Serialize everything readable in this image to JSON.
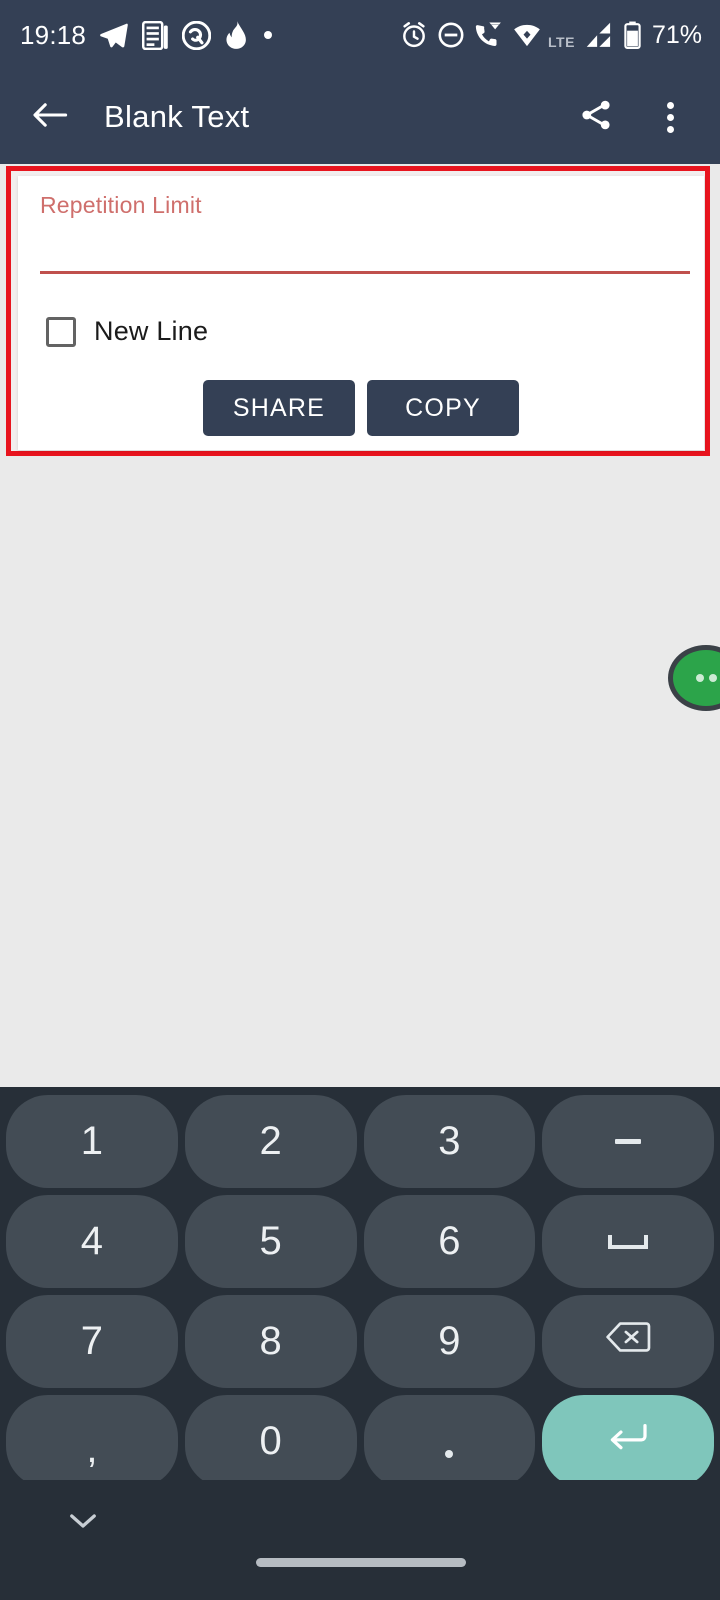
{
  "status_bar": {
    "time": "19:18",
    "battery_percent": "71%",
    "network_type": "LTE",
    "left_icons": [
      "telegram-icon",
      "news-document-icon",
      "circle-app-icon",
      "flame-icon",
      "dot-icon"
    ],
    "right_icons": [
      "alarm-clock-icon",
      "do-not-disturb-icon",
      "phone-wifi-calling-icon",
      "wifi-icon",
      "signal-bars-icon",
      "battery-icon"
    ],
    "background_color": "#344055"
  },
  "app_bar": {
    "title": "Blank Text",
    "back_icon": "arrow-left-icon",
    "share_icon": "share-icon",
    "overflow_icon": "more-vertical-icon",
    "background_color": "#344055"
  },
  "card": {
    "highlight_border_color": "#e8141e",
    "field": {
      "label": "Repetition Limit",
      "value": "",
      "placeholder": "",
      "label_color": "#cf6f6c",
      "underline_color": "#c0504d"
    },
    "checkbox": {
      "label": "New Line",
      "checked": false
    },
    "buttons": [
      {
        "label": "SHARE",
        "name": "share-button"
      },
      {
        "label": "COPY",
        "name": "copy-button"
      }
    ],
    "button_color": "#344055"
  },
  "floating_bubble": {
    "icon": "three-dots-icon",
    "color": "#2ca44a"
  },
  "keyboard": {
    "background_color": "#272f38",
    "key_color": "#434c55",
    "enter_key_color": "#7fc6bb",
    "rows": [
      [
        {
          "label": "1",
          "name": "key-1",
          "glyph": "text"
        },
        {
          "label": "2",
          "name": "key-2",
          "glyph": "text"
        },
        {
          "label": "3",
          "name": "key-3",
          "glyph": "text"
        },
        {
          "label": "-",
          "name": "key-minus",
          "glyph": "dash"
        }
      ],
      [
        {
          "label": "4",
          "name": "key-4",
          "glyph": "text"
        },
        {
          "label": "5",
          "name": "key-5",
          "glyph": "text"
        },
        {
          "label": "6",
          "name": "key-6",
          "glyph": "text"
        },
        {
          "label": "space",
          "name": "key-space",
          "glyph": "space"
        }
      ],
      [
        {
          "label": "7",
          "name": "key-7",
          "glyph": "text"
        },
        {
          "label": "8",
          "name": "key-8",
          "glyph": "text"
        },
        {
          "label": "9",
          "name": "key-9",
          "glyph": "text"
        },
        {
          "label": "backspace",
          "name": "key-backspace",
          "glyph": "backspace"
        }
      ],
      [
        {
          "label": ",",
          "name": "key-comma",
          "glyph": "comma"
        },
        {
          "label": "0",
          "name": "key-0",
          "glyph": "text"
        },
        {
          "label": ".",
          "name": "key-period",
          "glyph": "dot"
        },
        {
          "label": "enter",
          "name": "key-enter",
          "glyph": "enter"
        }
      ]
    ]
  },
  "nav_bar": {
    "hide_keyboard_icon": "chevron-down-icon",
    "gesture_pill": "home-gesture-pill"
  }
}
